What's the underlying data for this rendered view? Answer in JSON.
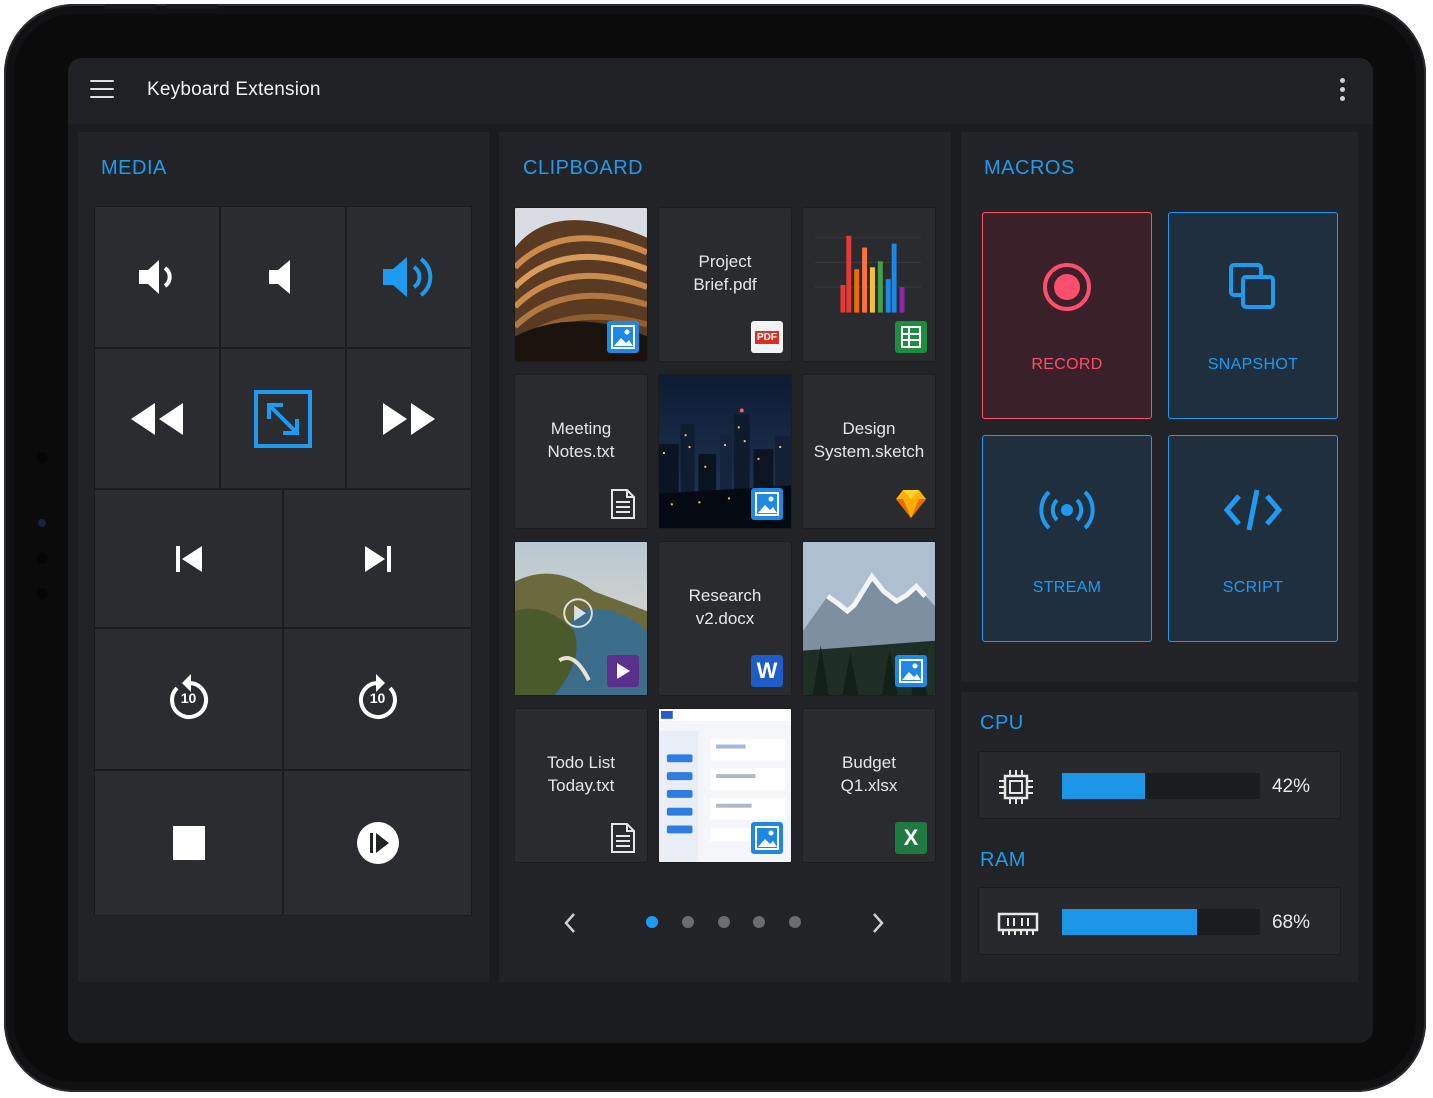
{
  "app": {
    "title": "Keyboard Extension"
  },
  "media": {
    "title": "MEDIA",
    "buttons": [
      "volume-down-icon",
      "volume-mute-icon",
      "volume-up-icon",
      "rewind-icon",
      "fullscreen-icon",
      "fast-forward-icon",
      "skip-previous-icon",
      "skip-next-icon",
      "replay-10-icon",
      "forward-10-icon",
      "stop-icon",
      "play-pause-icon"
    ],
    "replay_label": "10",
    "forward_label": "10"
  },
  "clipboard": {
    "title": "CLIPBOARD",
    "items": [
      {
        "type": "image",
        "name": "",
        "badge": "image-icon"
      },
      {
        "type": "file",
        "name": "Project Brief.pdf",
        "badge": "pdf-icon",
        "badge_text": "PDF"
      },
      {
        "type": "image",
        "name": "",
        "badge": "sheets-icon"
      },
      {
        "type": "file",
        "name": "Meeting Notes.txt",
        "badge": "text-file-icon"
      },
      {
        "type": "image",
        "name": "",
        "badge": "image-icon"
      },
      {
        "type": "file",
        "name": "Design System.sketch",
        "badge": "sketch-icon"
      },
      {
        "type": "video",
        "name": "",
        "badge": "video-icon"
      },
      {
        "type": "file",
        "name": "Research v2.docx",
        "badge": "word-icon",
        "badge_text": "W"
      },
      {
        "type": "image",
        "name": "",
        "badge": "image-icon"
      },
      {
        "type": "file",
        "name": "Todo List Today.txt",
        "badge": "text-file-icon"
      },
      {
        "type": "image",
        "name": "",
        "badge": "image-icon"
      },
      {
        "type": "file",
        "name": "Budget Q1.xlsx",
        "badge": "excel-icon",
        "badge_text": "X"
      }
    ],
    "pagination": {
      "pages": 5,
      "current": 1
    }
  },
  "macros": {
    "title": "MACROS",
    "items": [
      {
        "label": "RECORD",
        "icon": "record-icon",
        "color": "#ff4d6d"
      },
      {
        "label": "SNAPSHOT",
        "icon": "copy-icon",
        "color": "#1e9bf0"
      },
      {
        "label": "STREAM",
        "icon": "broadcast-icon",
        "color": "#1e9bf0"
      },
      {
        "label": "SCRIPT",
        "icon": "code-icon",
        "color": "#1e9bf0"
      }
    ]
  },
  "cpu": {
    "title": "CPU",
    "percent_text": "42%",
    "value": 0.42
  },
  "ram": {
    "title": "RAM",
    "percent_text": "68%",
    "value": 0.68
  },
  "colors": {
    "accent": "#1e9bf0",
    "record": "#ff4d6d",
    "background": "#1b1c1e",
    "panel": "#222326"
  }
}
